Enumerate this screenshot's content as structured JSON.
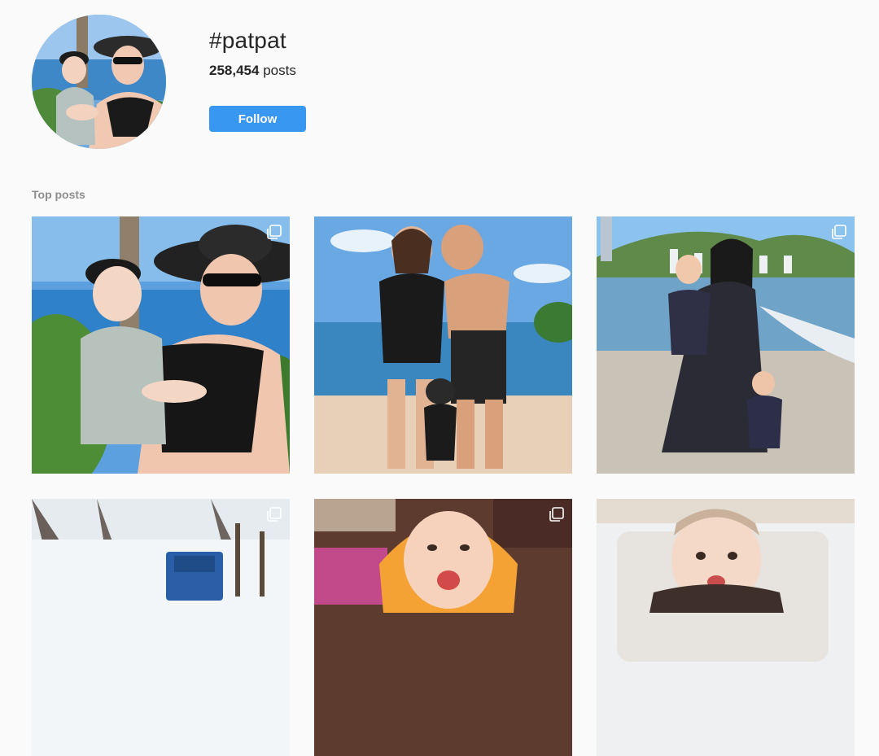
{
  "header": {
    "hashtag": "#patpat",
    "posts_count": "258,454",
    "posts_label": "posts",
    "follow_label": "Follow"
  },
  "section": {
    "top_posts_label": "Top posts"
  },
  "posts": [
    {
      "description": "mother and baby in black hats at resort pool",
      "multi": true
    },
    {
      "description": "couple kissing on beach in MAMA and PAPA swimwear with toddler",
      "multi": false
    },
    {
      "description": "mother and daughters in matching floral outfits on beach",
      "multi": true
    },
    {
      "description": "snowy village road with blue truck",
      "multi": true
    },
    {
      "description": "smiling baby in orange hooded towel",
      "multi": true
    },
    {
      "description": "smiling baby in ruffled outfit",
      "multi": false
    }
  ],
  "icons": {
    "avatar": "profile-image",
    "multi_post": "carousel-icon"
  },
  "colors": {
    "follow_button": "#3897f0",
    "background": "#fafafa",
    "secondary_text": "#8e8e8e"
  }
}
